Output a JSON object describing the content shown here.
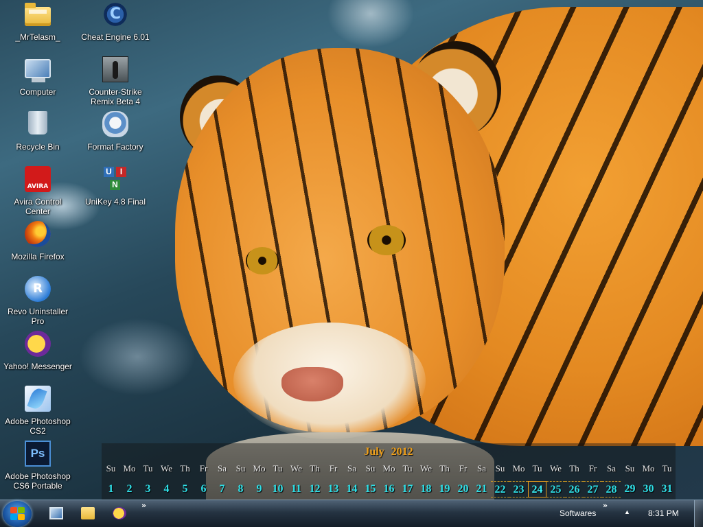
{
  "desktop": {
    "icons_left": [
      {
        "label": "_MrTelasm_",
        "icon": "folder-icon"
      },
      {
        "label": "Computer",
        "icon": "computer-icon"
      },
      {
        "label": "Recycle Bin",
        "icon": "recycle-bin-icon"
      },
      {
        "label": "Avira Control Center",
        "icon": "avira-icon",
        "glyph_text": "AVIRA"
      },
      {
        "label": "Mozilla Firefox",
        "icon": "firefox-icon"
      },
      {
        "label": "Revo Uninstaller Pro",
        "icon": "revo-uninstaller-icon",
        "glyph_text": "R"
      },
      {
        "label": "Yahoo! Messenger",
        "icon": "yahoo-messenger-icon"
      },
      {
        "label": "Adobe Photoshop CS2",
        "icon": "photoshop-cs2-icon"
      },
      {
        "label": "Adobe Photoshop CS6 Portable",
        "icon": "photoshop-cs6-icon",
        "glyph_text": "Ps"
      }
    ],
    "icons_right": [
      {
        "label": "Cheat Engine 6.01",
        "icon": "cheat-engine-icon",
        "glyph_text": "C"
      },
      {
        "label": "Counter-Strike Remix Beta 4",
        "icon": "counter-strike-icon"
      },
      {
        "label": "Format Factory",
        "icon": "format-factory-icon"
      },
      {
        "label": "UniKey 4.8 Final",
        "icon": "unikey-icon",
        "glyph_letters": [
          "U",
          "I",
          "N"
        ]
      }
    ]
  },
  "calendar": {
    "month": "July",
    "year": "2012",
    "weekdays": [
      "Su",
      "Mo",
      "Tu",
      "We",
      "Th",
      "Fr",
      "Sa",
      "Su",
      "Mo",
      "Tu",
      "We",
      "Th",
      "Fr",
      "Sa",
      "Su",
      "Mo",
      "Tu",
      "We",
      "Th",
      "Fr",
      "Sa",
      "Su",
      "Mo",
      "Tu",
      "We",
      "Th",
      "Fr",
      "Sa",
      "Su",
      "Mo",
      "Tu"
    ],
    "dates": [
      "1",
      "2",
      "3",
      "4",
      "5",
      "6",
      "7",
      "8",
      "9",
      "10",
      "11",
      "12",
      "13",
      "14",
      "15",
      "16",
      "17",
      "18",
      "19",
      "20",
      "21",
      "22",
      "23",
      "24",
      "25",
      "26",
      "27",
      "28",
      "29",
      "30",
      "31"
    ],
    "today": "24",
    "colors": {
      "title": "#f0a01a",
      "dates": "#2fe0e8",
      "weekdays": "#e8e8e8"
    }
  },
  "taskbar": {
    "start_icon": "windows-start-icon",
    "pinned": [
      {
        "name": "monitor-icon"
      },
      {
        "name": "folder-icon"
      },
      {
        "name": "yahoo-messenger-icon"
      }
    ],
    "overflow_chevron": "»",
    "toolbar_label": "Softwares",
    "toolbar_chevron": "»",
    "tray_arrow": "▲",
    "clock": "8:31 PM"
  }
}
